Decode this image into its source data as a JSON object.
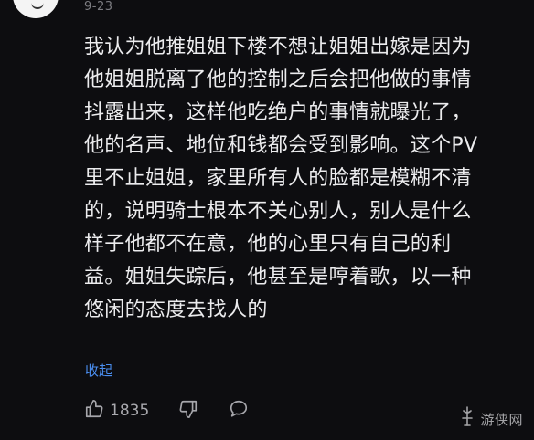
{
  "comment": {
    "date": "9-23",
    "lines": [
      "我认为他推姐姐下楼不想让姐姐出嫁是因为",
      "他姐姐脱离了他的控制之后会把他做的事情",
      "抖露出来，这样他吃绝户的事情就曝光了，",
      "他的名声、地位和钱都会受到影响。这个PV",
      "里不止姐姐，家里所有人的脸都是模糊不清",
      "的，说明骑士根本不关心别人，别人是什么",
      "样子他都不在意，他的心里只有自己的利",
      "益。姐姐失踪后，他甚至是哼着歌，以一种",
      "悠闲的态度去找人的"
    ],
    "collapse_label": "收起"
  },
  "actions": {
    "like_count": "1835"
  },
  "watermark": {
    "text": "游侠网"
  },
  "icons": {
    "like": "thumbs-up-icon",
    "dislike": "thumbs-down-icon",
    "reply": "comment-bubble-icon"
  },
  "colors": {
    "background": "#0d0d10",
    "text": "#ececee",
    "link": "#4a8ef0",
    "muted": "#a6a6ab"
  }
}
